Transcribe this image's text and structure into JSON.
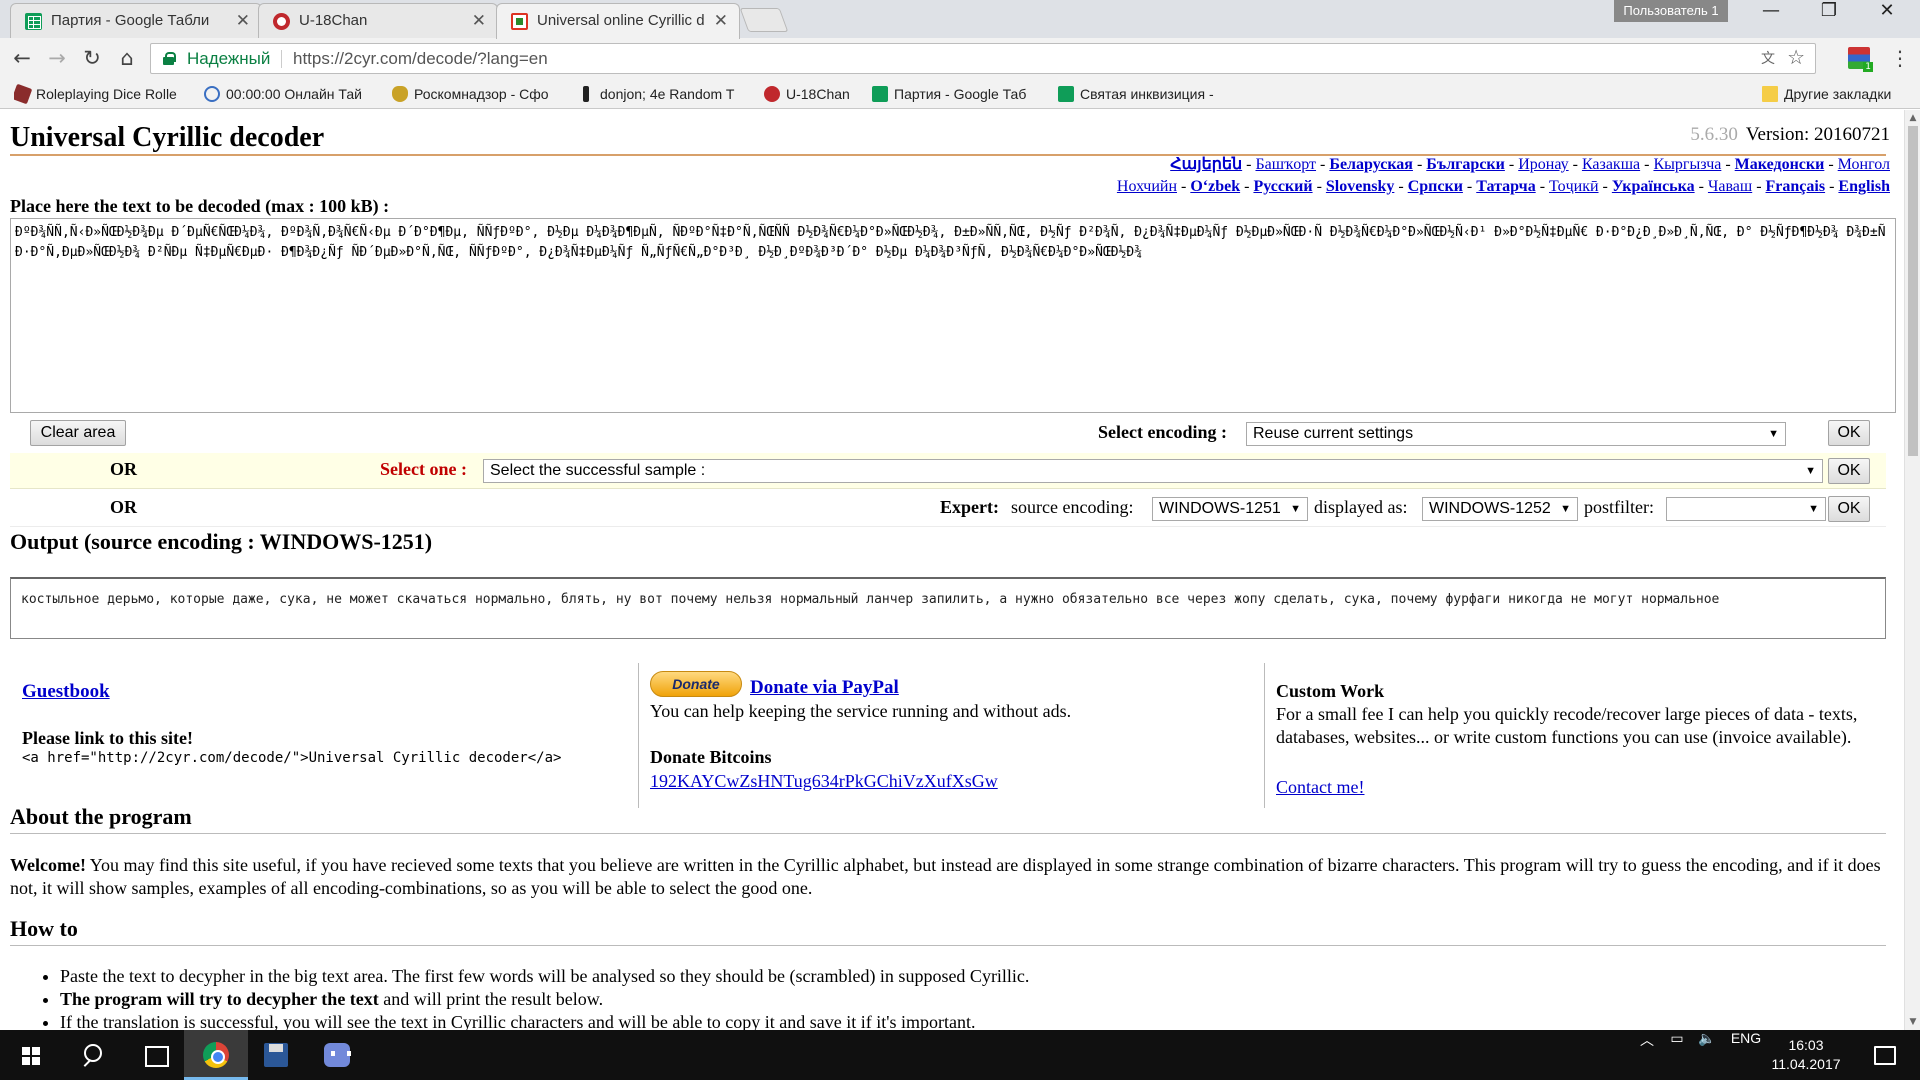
{
  "browser": {
    "tabs": [
      {
        "title": "Партия - Google Табли"
      },
      {
        "title": "U-18Chan"
      },
      {
        "title": "Universal online Cyrillic d"
      }
    ],
    "profile": "Пользователь 1",
    "secure_label": "Надежный",
    "url": "https://2cyr.com/decode/?lang=en",
    "bookmarks": [
      "Roleplaying Dice Rolle",
      "00:00:00 Онлайн Тай",
      "Роскомнадзор - Сфо",
      "donjon; 4e Random T",
      "U-18Chan",
      "Партия - Google Таб",
      "Святая инквизиция -"
    ],
    "other_bookmarks": "Другие закладки"
  },
  "page": {
    "title": "Universal Cyrillic decoder",
    "version_num": "5.6.30",
    "version_label": "Version: 20160721",
    "languages_row1": [
      "Հայերեն",
      "Башҡорт",
      "Беларуская",
      "Български",
      "Иронау",
      "Казакша",
      "Кыргызча",
      "Македонски",
      "Монгол"
    ],
    "languages_row2": [
      "Нохчийн",
      "O‘zbek",
      "Русский",
      "Slovensky",
      "Српски",
      "Татарча",
      "Тоҷикӣ",
      "Українська",
      "Чаваш",
      "Français",
      "English"
    ],
    "input_label": "Place here the text to be decoded (max : 100 kB) :",
    "input_text": "ÐºÐ¾ÑÑ‚Ñ‹Ð»ÑŒÐ½Ð¾Ðµ Ð´ÐµÑ€ÑŒÐ¼Ð¾, ÐºÐ¾Ñ‚Ð¾Ñ€Ñ‹Ðµ Ð´Ð°Ð¶Ðµ, ÑÑƒÐºÐ°, Ð½Ðµ Ð¼Ð¾Ð¶ÐµÑ‚ ÑÐºÐ°Ñ‡Ð°Ñ‚ÑŒÑÑ Ð½Ð¾Ñ€Ð¼Ð°Ð»ÑŒÐ½Ð¾, Ð±Ð»ÑÑ‚ÑŒ, Ð½Ñƒ Ð²Ð¾Ñ‚ Ð¿Ð¾Ñ‡ÐµÐ¼Ñƒ Ð½ÐµÐ»ÑŒÐ·Ñ Ð½Ð¾Ñ€Ð¼Ð°Ð»ÑŒÐ½Ñ‹Ð¹ Ð»Ð°Ð½Ñ‡ÐµÑ€ Ð·Ð°Ð¿Ð¸Ð»Ð¸Ñ‚ÑŒ, Ð° Ð½ÑƒÐ¶Ð½Ð¾ Ð¾Ð±ÑÐ·Ð°Ñ‚ÐµÐ»ÑŒÐ½Ð¾ Ð²ÑÐµ Ñ‡ÐµÑ€ÐµÐ· Ð¶Ð¾Ð¿Ñƒ ÑÐ´ÐµÐ»Ð°Ñ‚ÑŒ, ÑÑƒÐºÐ°, Ð¿Ð¾Ñ‡ÐµÐ¼Ñƒ Ñ„ÑƒÑ€Ñ„Ð°Ð³Ð¸ Ð½Ð¸ÐºÐ¾Ð³Ð´Ð° Ð½Ðµ Ð¼Ð¾Ð³ÑƒÑ‚ Ð½Ð¾Ñ€Ð¼Ð°Ð»ÑŒÐ½Ð¾",
    "clear_button": "Clear area",
    "select_encoding_label": "Select encoding :",
    "select_encoding_value": "Reuse current settings",
    "ok": "OK",
    "or": "OR",
    "select_one_label": "Select one :",
    "select_one_value": "Select the successful sample :",
    "expert_label": "Expert:",
    "source_encoding_label": "source encoding:",
    "source_encoding_value": "WINDOWS-1251",
    "displayed_as_label": "displayed as:",
    "displayed_as_value": "WINDOWS-1252",
    "postfilter_label": "postfilter:",
    "postfilter_value": "",
    "output_title": "Output (source encoding : WINDOWS-1251)",
    "output_text": "костыльное дерьмо, которые даже, сука, не может скачаться нормально, блять, ну вот почему нельзя нормальный ланчер запилить, а нужно обязательно все через жопу сделать, сука, почему фурфаги никогда не могут нормальное",
    "guestbook": "Guestbook",
    "link_title": "Please link to this site!",
    "link_code": "<a href=\"http://2cyr.com/decode/\">Universal Cyrillic decoder</a>",
    "donate_button": "Donate",
    "donate_link": "Donate via PayPal",
    "donate_text": "You can help keeping the service running and without ads.",
    "btc_title": "Donate Bitcoins",
    "btc_address": "192KAYCwZsHNTug634rPkGChiVzXufXsGw",
    "custom_title": "Custom Work",
    "custom_text": "For a small fee I can help you quickly recode/recover large pieces of data - texts, databases, websites... or write custom functions you can use (invoice available).",
    "contact_link": "Contact me!",
    "about_title": "About the program",
    "welcome_bold": "Welcome!",
    "welcome_text": " You may find this site useful, if you have recieved some texts that you believe are written in the Cyrillic alphabet, but instead are displayed in some strange combination of bizarre characters. This program will try to guess the encoding, and if it does not, it will show samples, examples of all encoding-combinations, so as you will be able to select the good one.",
    "howto_title": "How to",
    "howto_1": "Paste the text to decypher in the big text area. The first few words will be analysed so they should be (scrambled) in supposed Cyrillic.",
    "howto_2_bold": "The program will try to decypher the text",
    "howto_2": " and will print the result below.",
    "howto_3": "If the translation is successful, you will see the text in Cyrillic characters and will be able to copy it and save it if it's important."
  },
  "taskbar": {
    "lang": "ENG",
    "time": "16:03",
    "date": "11.04.2017"
  }
}
